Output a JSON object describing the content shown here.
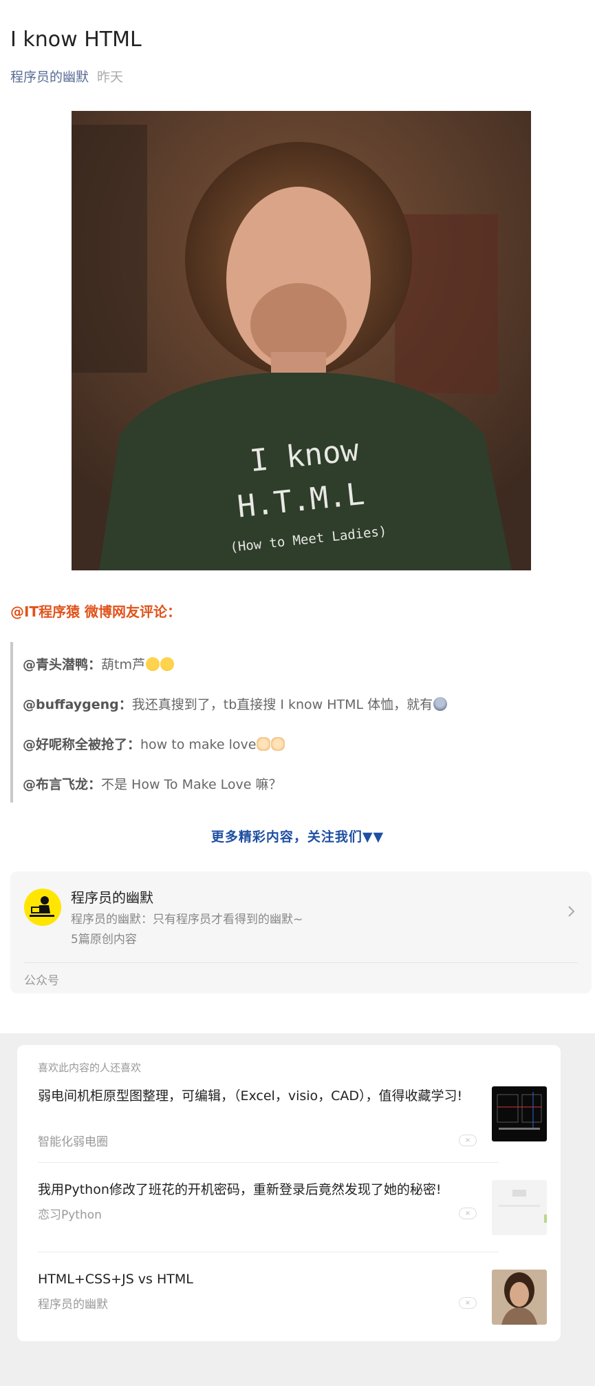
{
  "article": {
    "title": "I know HTML",
    "author": "程序员的幽默",
    "date": "昨天"
  },
  "hero_image": {
    "alt_subject": "man in green t-shirt",
    "shirt_line1": "I know",
    "shirt_line2": "H.T.M.L",
    "shirt_line3": "(How to Meet Ladies)"
  },
  "weibo": {
    "title": "@IT程序猿 微博网友评论：",
    "comments": [
      {
        "user": "@青头潜鸭：",
        "text": "葫tm芦",
        "emoji": "laughing-emoji"
      },
      {
        "user": "@buffaygeng：",
        "text": "我还真搜到了，tb直接搜 I know HTML 体恤，就有",
        "emoji": "scared-emoji"
      },
      {
        "user": "@好呢称全被抢了：",
        "text": "how to make love",
        "emoji": "cat-emoji"
      },
      {
        "user": "@布言飞龙：",
        "text": "不是 How To Make Love 嘛？",
        "emoji": ""
      }
    ]
  },
  "follow_text": "更多精彩内容，关注我们▼▼",
  "account": {
    "name": "程序员的幽默",
    "desc": "程序员的幽默：只有程序员才看得到的幽默~",
    "count": "5篇原创内容",
    "type": "公众号"
  },
  "recommend": {
    "title": "喜欢此内容的人还喜欢",
    "items": [
      {
        "text": "弱电间机柜原型图整理，可编辑，（Excel，visio，CAD），值得收藏学习!",
        "source": "智能化弱电圈"
      },
      {
        "text": "我用Python修改了班花的开机密码，重新登录后竟然发现了她的秘密!",
        "source": "恋习Python"
      },
      {
        "text": "HTML+CSS+JS vs HTML",
        "source": "程序员的幽默"
      }
    ],
    "close_glyph": "×"
  },
  "colors": {
    "accent_orange": "#e0541c",
    "link_blue": "#576b95",
    "follow_blue": "#1f4fa3"
  }
}
